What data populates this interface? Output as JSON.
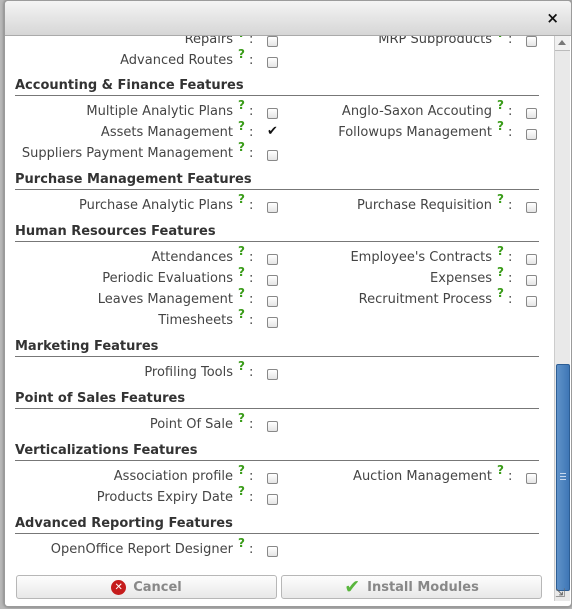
{
  "dialog": {
    "close_label": "×"
  },
  "rows": [
    {
      "left": {
        "label": "Repairs",
        "help": "?",
        "checked": false
      },
      "right": {
        "label": "MRP Subproducts",
        "help": "?",
        "checked": false
      }
    },
    {
      "left": {
        "label": "Advanced Routes",
        "help": "?",
        "checked": false
      }
    },
    {
      "section": "Accounting & Finance Features"
    },
    {
      "left": {
        "label": "Multiple Analytic Plans",
        "help": "?",
        "checked": false
      },
      "right": {
        "label": "Anglo-Saxon Accouting",
        "help": "?",
        "checked": false
      }
    },
    {
      "left": {
        "label": "Assets Management",
        "help": "?",
        "checked": true
      },
      "right": {
        "label": "Followups Management",
        "help": "?",
        "checked": false
      }
    },
    {
      "left": {
        "label": "Suppliers Payment Management",
        "help": "?",
        "checked": false
      }
    },
    {
      "section": "Purchase Management Features"
    },
    {
      "left": {
        "label": "Purchase Analytic Plans",
        "help": "?",
        "checked": false
      },
      "right": {
        "label": "Purchase Requisition",
        "help": "?",
        "checked": false
      }
    },
    {
      "section": "Human Resources Features"
    },
    {
      "left": {
        "label": "Attendances",
        "help": "?",
        "checked": false
      },
      "right": {
        "label": "Employee's Contracts",
        "help": "?",
        "checked": false
      }
    },
    {
      "left": {
        "label": "Periodic Evaluations",
        "help": "?",
        "checked": false
      },
      "right": {
        "label": "Expenses",
        "help": "?",
        "checked": false
      }
    },
    {
      "left": {
        "label": "Leaves Management",
        "help": "?",
        "checked": false
      },
      "right": {
        "label": "Recruitment Process",
        "help": "?",
        "checked": false
      }
    },
    {
      "left": {
        "label": "Timesheets",
        "help": "?",
        "checked": false
      }
    },
    {
      "section": "Marketing Features"
    },
    {
      "left": {
        "label": "Profiling Tools",
        "help": "?",
        "checked": false
      }
    },
    {
      "section": "Point of Sales Features"
    },
    {
      "left": {
        "label": "Point Of Sale",
        "help": "?",
        "checked": false
      }
    },
    {
      "section": "Verticalizations Features"
    },
    {
      "left": {
        "label": "Association profile",
        "help": "?",
        "checked": false
      },
      "right": {
        "label": "Auction Management",
        "help": "?",
        "checked": false
      }
    },
    {
      "left": {
        "label": "Products Expiry Date",
        "help": "?",
        "checked": false
      }
    },
    {
      "section": "Advanced Reporting Features"
    },
    {
      "left": {
        "label": "OpenOffice Report Designer",
        "help": "?",
        "checked": false
      }
    }
  ],
  "footer": {
    "cancel_label": "Cancel",
    "install_label": "Install Modules"
  },
  "colors": {
    "help_icon": "#3a9c19",
    "scroll_thumb": "#3f77b6",
    "cancel_icon": "#c51c1c",
    "install_icon": "#59b63d"
  },
  "icons": [
    "close-icon",
    "help-icon",
    "checkmark-icon",
    "cancel-icon",
    "check-icon"
  ]
}
